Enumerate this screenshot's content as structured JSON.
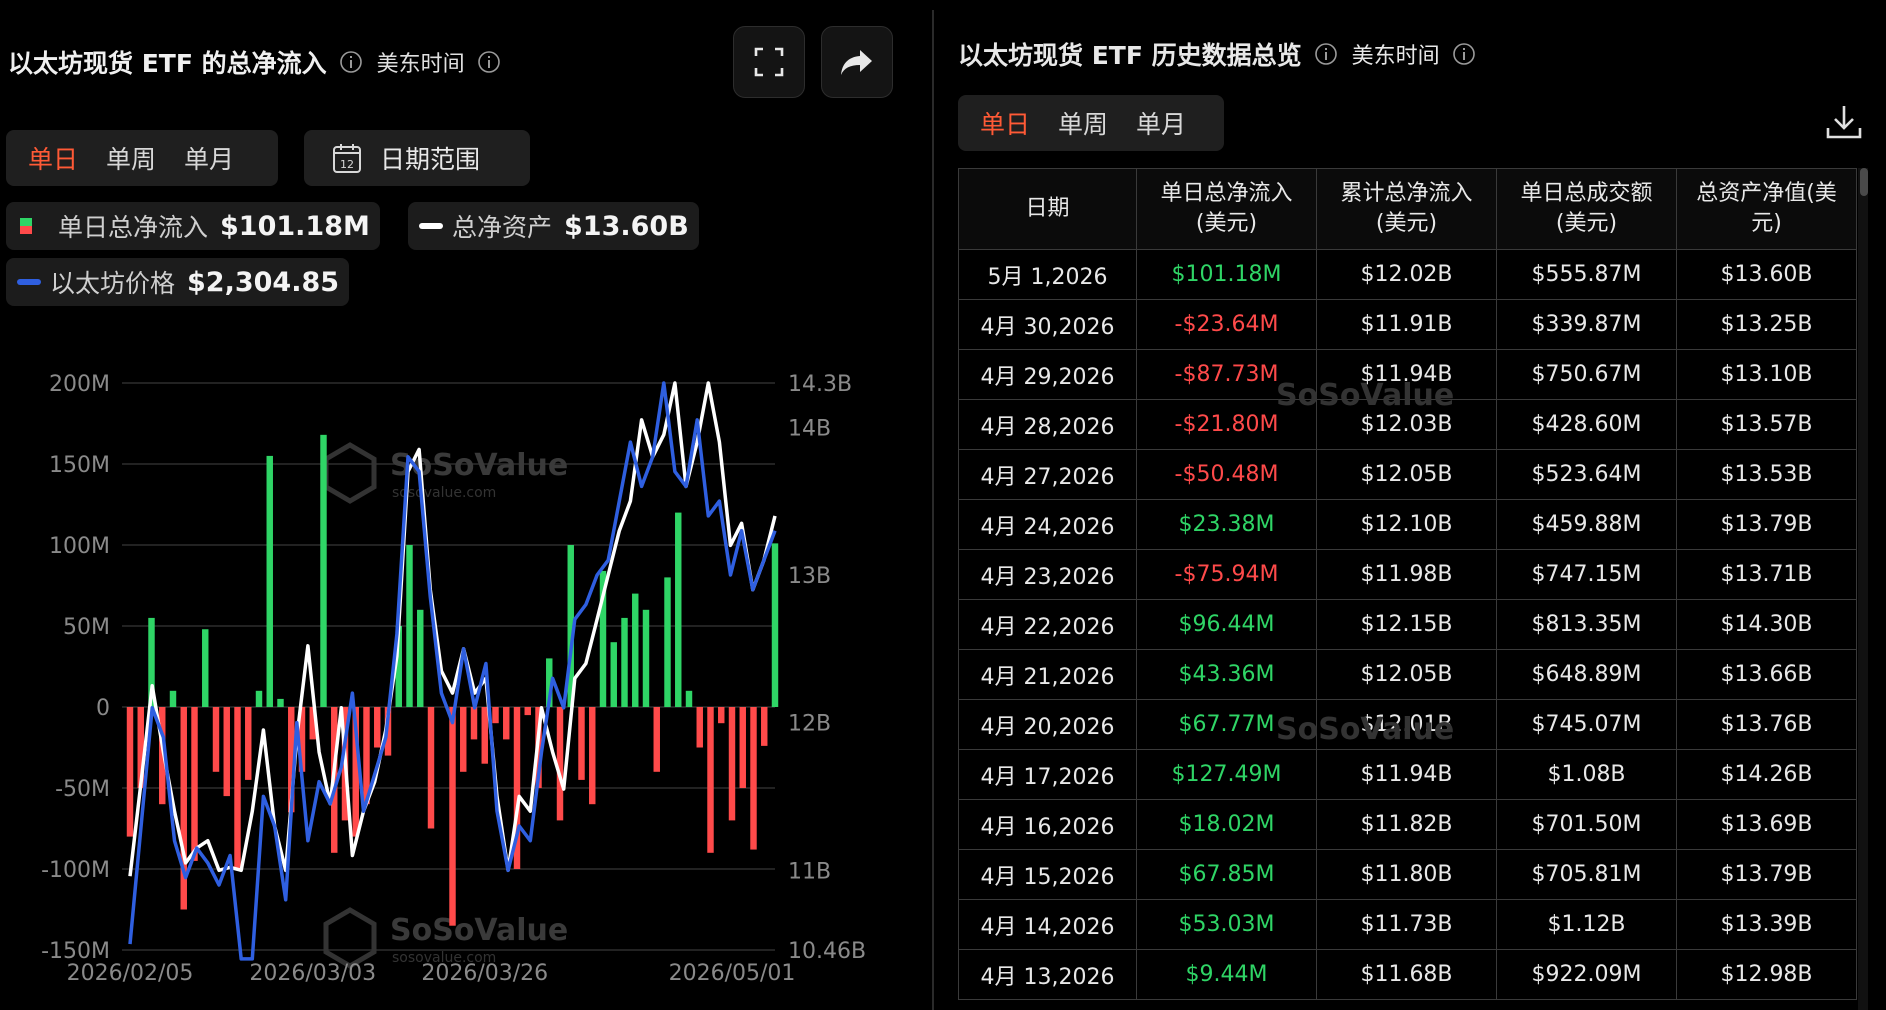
{
  "left": {
    "title": "以太坊现货 ETF 的总净流入",
    "timezone": "美东时间",
    "tabs": [
      "单日",
      "单周",
      "单月"
    ],
    "active_tab": 0,
    "date_range_label": "日期范围",
    "calendar_day": "12",
    "legend": [
      {
        "label": "单日总净流入",
        "value": "$101.18M"
      },
      {
        "label": "总净资产",
        "value": "$13.60B"
      },
      {
        "label": "以太坊价格",
        "value": "$2,304.85"
      }
    ]
  },
  "right": {
    "title": "以太坊现货 ETF 历史数据总览",
    "timezone": "美东时间",
    "tabs": [
      "单日",
      "单周",
      "单月"
    ],
    "active_tab": 0,
    "columns": [
      "日期",
      "单日总净流入\n(美元)",
      "累计总净流入\n(美元)",
      "单日总成交额\n(美元)",
      "总资产净值(美\n元)"
    ],
    "rows": [
      [
        "5月 1,2026",
        "$101.18M",
        "$12.02B",
        "$555.87M",
        "$13.60B"
      ],
      [
        "4月 30,2026",
        "-$23.64M",
        "$11.91B",
        "$339.87M",
        "$13.25B"
      ],
      [
        "4月 29,2026",
        "-$87.73M",
        "$11.94B",
        "$750.67M",
        "$13.10B"
      ],
      [
        "4月 28,2026",
        "-$21.80M",
        "$12.03B",
        "$428.60M",
        "$13.57B"
      ],
      [
        "4月 27,2026",
        "-$50.48M",
        "$12.05B",
        "$523.64M",
        "$13.53B"
      ],
      [
        "4月 24,2026",
        "$23.38M",
        "$12.10B",
        "$459.88M",
        "$13.79B"
      ],
      [
        "4月 23,2026",
        "-$75.94M",
        "$11.98B",
        "$747.15M",
        "$13.71B"
      ],
      [
        "4月 22,2026",
        "$96.44M",
        "$12.15B",
        "$813.35M",
        "$14.30B"
      ],
      [
        "4月 21,2026",
        "$43.36M",
        "$12.05B",
        "$648.89M",
        "$13.66B"
      ],
      [
        "4月 20,2026",
        "$67.77M",
        "$12.01B",
        "$745.07M",
        "$13.76B"
      ],
      [
        "4月 17,2026",
        "$127.49M",
        "$11.94B",
        "$1.08B",
        "$14.26B"
      ],
      [
        "4月 16,2026",
        "$18.02M",
        "$11.82B",
        "$701.50M",
        "$13.69B"
      ],
      [
        "4月 15,2026",
        "$67.85M",
        "$11.80B",
        "$705.81M",
        "$13.79B"
      ],
      [
        "4月 14,2026",
        "$53.03M",
        "$11.73B",
        "$1.12B",
        "$13.39B"
      ],
      [
        "4月 13,2026",
        "$9.44M",
        "$11.68B",
        "$922.09M",
        "$12.98B"
      ]
    ]
  },
  "watermark": {
    "brand": "SoSoValue",
    "domain": "sosovalue.com"
  },
  "colors": {
    "positive": "#2fd566",
    "negative": "#ff4a4a",
    "assets_line": "#ffffff",
    "price_line": "#2f5fe0",
    "accent": "#ff5a36"
  },
  "chart_data": {
    "type": "bar",
    "x_ticks": [
      "2026/02/05",
      "2026/03/03",
      "2026/03/26",
      "2026/05/01"
    ],
    "x_tick_index": [
      0,
      17,
      33,
      56
    ],
    "left_axis": {
      "ticks": [
        "200M",
        "150M",
        "100M",
        "50M",
        "0",
        "-50M",
        "-100M",
        "-150M"
      ],
      "tick_values": [
        200,
        150,
        100,
        50,
        0,
        -50,
        -100,
        -150
      ],
      "ylim": [
        -150,
        200
      ],
      "unit": "M"
    },
    "right_axis": {
      "ticks": [
        "14.3B",
        "14B",
        "13B",
        "12B",
        "11B",
        "10.46B"
      ],
      "tick_values": [
        14.3,
        14,
        13,
        12,
        11,
        10.46
      ],
      "ylim": [
        10.46,
        14.3
      ],
      "unit": "B"
    },
    "grid": true,
    "series": [
      {
        "name": "单日总净流入",
        "type": "bar",
        "axis": "left",
        "values": [
          -80,
          -50,
          55,
          -60,
          10,
          -125,
          -95,
          48,
          -40,
          -55,
          -100,
          -45,
          10,
          155,
          5,
          -65,
          -40,
          -20,
          168,
          -90,
          -70,
          -80,
          -60,
          -25,
          -30,
          50,
          100,
          60,
          -75,
          0,
          -135,
          -40,
          -20,
          -35,
          -10,
          -20,
          -100,
          -5,
          -50,
          30,
          -70,
          100,
          -45,
          -60,
          84,
          40,
          55,
          70,
          60,
          -40,
          80,
          120,
          10,
          -25,
          -90,
          -10,
          -70,
          -50,
          -88,
          -24,
          101
        ]
      },
      {
        "name": "总净资产",
        "type": "line",
        "axis": "right",
        "values": [
          10.96,
          11.6,
          12.25,
          11.8,
          11.4,
          11.05,
          11.15,
          11.2,
          11.0,
          11.02,
          11.0,
          11.4,
          11.95,
          11.3,
          11.0,
          11.9,
          12.52,
          11.8,
          11.45,
          12.1,
          11.1,
          11.4,
          11.6,
          11.95,
          12.45,
          13.7,
          13.85,
          12.9,
          12.35,
          12.2,
          12.5,
          12.2,
          12.3,
          11.5,
          11.0,
          11.5,
          11.4,
          12.1,
          11.8,
          11.55,
          12.3,
          12.4,
          12.7,
          13.0,
          13.3,
          13.5,
          14.05,
          13.8,
          13.95,
          14.3,
          13.6,
          13.9,
          14.3,
          13.9,
          13.2,
          13.35,
          12.9,
          13.1,
          13.4
        ]
      },
      {
        "name": "以太坊价格",
        "type": "line",
        "axis": "right",
        "values": [
          10.5,
          11.3,
          12.1,
          11.9,
          11.2,
          10.95,
          11.15,
          11.05,
          10.9,
          11.1,
          10.4,
          10.4,
          11.5,
          11.3,
          10.8,
          12.0,
          11.2,
          11.6,
          11.45,
          11.7,
          12.2,
          11.4,
          11.65,
          11.9,
          12.6,
          13.8,
          13.7,
          12.85,
          12.2,
          12.0,
          12.5,
          12.1,
          12.4,
          11.4,
          11.0,
          11.3,
          11.2,
          11.8,
          12.3,
          12.1,
          12.7,
          12.8,
          13.0,
          13.1,
          13.5,
          13.9,
          13.6,
          13.8,
          14.3,
          13.7,
          13.6,
          14.05,
          13.4,
          13.5,
          13.0,
          13.3,
          12.9,
          13.1,
          13.3
        ]
      }
    ]
  }
}
